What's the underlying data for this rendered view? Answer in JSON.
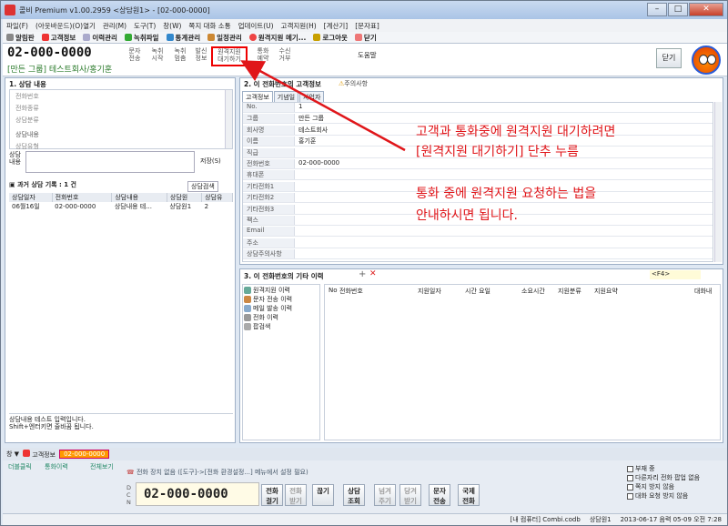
{
  "window": {
    "title": "콜비 Premium v1.00.2959 <상담원1> - [02-000-0000]"
  },
  "menu": [
    "파일(F)",
    "(아웃바운드)(O)열기",
    "관리(M)",
    "도구(T)",
    "창(W)",
    "쪽지 대화 소통",
    "업데이트(U)",
    "고객지원(H)",
    "[계산기]",
    "[문자표]"
  ],
  "toolbar": [
    "알림판",
    "고객정보",
    "이력관리",
    "녹취파일",
    "통계관리",
    "일정관리",
    "원격지원 메기...",
    "로그아웃",
    "닫기"
  ],
  "header": {
    "phone": "02-000-0000",
    "company": "[만든 그룹] 테스트회사/홍기훈",
    "buttons": [
      "문자\n전송",
      "녹취\n시작",
      "녹취\n멈춤",
      "발신\n정보",
      "원격지원\n대기하기",
      "통화\n예약",
      "수신\n거부"
    ],
    "help": "도움말",
    "close": "닫기"
  },
  "left": {
    "title": "1. 상담 내용",
    "fields": [
      "전화번호",
      "전화종류",
      "상담분류",
      "상담내용",
      "상담유형"
    ],
    "consult_label": "상담\n내용",
    "save": "저장(S)",
    "history_title": "과거 상담 기록 : 1 건",
    "search_btn": "상담검색",
    "history_headers": [
      "상담일자",
      "전화번호",
      "상담내용",
      "상담원",
      "상담유"
    ],
    "history_rows": [
      [
        "06월16일",
        "02-000-0000",
        "상담내용 테...",
        "상담원1",
        "2"
      ]
    ],
    "footer1": "상담내용 테스트 입력입니다.",
    "footer2": "Shift+엔터키면 줄바꿈 됩니다."
  },
  "right": {
    "title": "2. 이 전화번호의 고객정보",
    "warn": "주의사항",
    "tabs": [
      "고객정보",
      "기념일",
      "사업자"
    ],
    "rows": [
      {
        "k": "No.",
        "v": "1"
      },
      {
        "k": "그룹",
        "v": "만든 그룹"
      },
      {
        "k": "회사명",
        "v": "테스트회사"
      },
      {
        "k": "이름",
        "v": "홍기훈"
      },
      {
        "k": "직급",
        "v": ""
      },
      {
        "k": "전화번호",
        "v": "02-000-0000"
      },
      {
        "k": "휴대폰",
        "v": ""
      },
      {
        "k": "기타전화1",
        "v": ""
      },
      {
        "k": "기타전화2",
        "v": ""
      },
      {
        "k": "기타전화3",
        "v": ""
      },
      {
        "k": "팩스",
        "v": ""
      },
      {
        "k": "Email",
        "v": ""
      },
      {
        "k": "주소",
        "v": ""
      },
      {
        "k": "상담주의사항",
        "v": ""
      }
    ]
  },
  "other": {
    "title": "3. 이 전화번호의 기타 이력",
    "f4": "<F4>",
    "tree": [
      "원격지원 이력",
      "문자 전송 이력",
      "메일 발송 이력",
      "전화 이력",
      "팝검색"
    ],
    "headers": [
      "No",
      "전화번호",
      "지원일자",
      "시간 요일",
      "소요시간",
      "지원분류",
      "지원요약",
      "대화내"
    ]
  },
  "annotation": {
    "line1": "고객과 통화중에 원격지원 대기하려면",
    "line2": "[원격지원 대기하기] 단추 누름",
    "line3": "통화 중에 원격지원 요청하는 법을",
    "line4": "안내하시면 됩니다."
  },
  "bottom": {
    "strip_label": "창 ▼",
    "strip_tab1": "고객정보",
    "strip_tab2": "02-000-0000",
    "links": [
      "더블클릭",
      "통화이력",
      "전체보기"
    ],
    "notice": "전화 장치 없음 ([도구]->[전화 환경설정...] 메뉴에서 설정 필요)",
    "dcn": "D\nC\nN",
    "phone": "02-000-0000",
    "buttons": [
      {
        "label": "전화\n걸기",
        "dis": false
      },
      {
        "label": "전화\n받기",
        "dis": true
      },
      {
        "label": "끊기",
        "dis": false
      },
      {
        "label": "상담\n조회",
        "dis": false
      },
      {
        "label": "넘겨\n주기",
        "dis": true
      },
      {
        "label": "당겨\n받기",
        "dis": true
      },
      {
        "label": "문자\n전송",
        "dis": false
      },
      {
        "label": "국제\n전화",
        "dis": false
      }
    ],
    "checks": [
      "부재 중",
      "다른자리 전화 팝업 없음",
      "쪽지 방지 않음",
      "대화 요청 방지 않음"
    ]
  },
  "status": [
    "[내 컴퓨터] Combi.codb",
    "상담원1",
    "2013-06-17  음력 05-09  오전 7:28"
  ]
}
